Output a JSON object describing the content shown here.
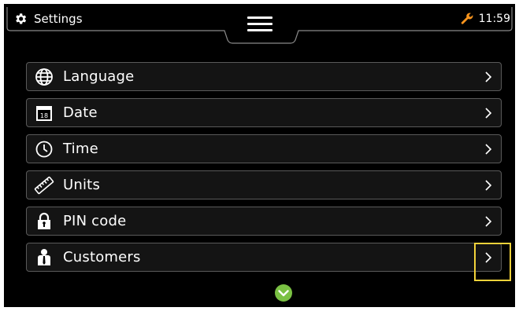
{
  "header": {
    "title": "Settings",
    "time": "11:59",
    "title_icon": "gear-icon",
    "menu_icon": "hamburger-menu-icon",
    "status_icon": "wrench-icon"
  },
  "settings_items": [
    {
      "label": "Language",
      "icon": "globe-icon"
    },
    {
      "label": "Date",
      "icon": "calendar-icon",
      "icon_text": "18"
    },
    {
      "label": "Time",
      "icon": "clock-icon"
    },
    {
      "label": "Units",
      "icon": "ruler-icon"
    },
    {
      "label": "PIN code",
      "icon": "lock-icon"
    },
    {
      "label": "Customers",
      "icon": "person-icon"
    }
  ],
  "colors": {
    "accent_orange": "#f7941d",
    "highlight_yellow": "#f2d23a",
    "scroll_green": "#7ac143",
    "item_border": "#5a5a5a"
  }
}
